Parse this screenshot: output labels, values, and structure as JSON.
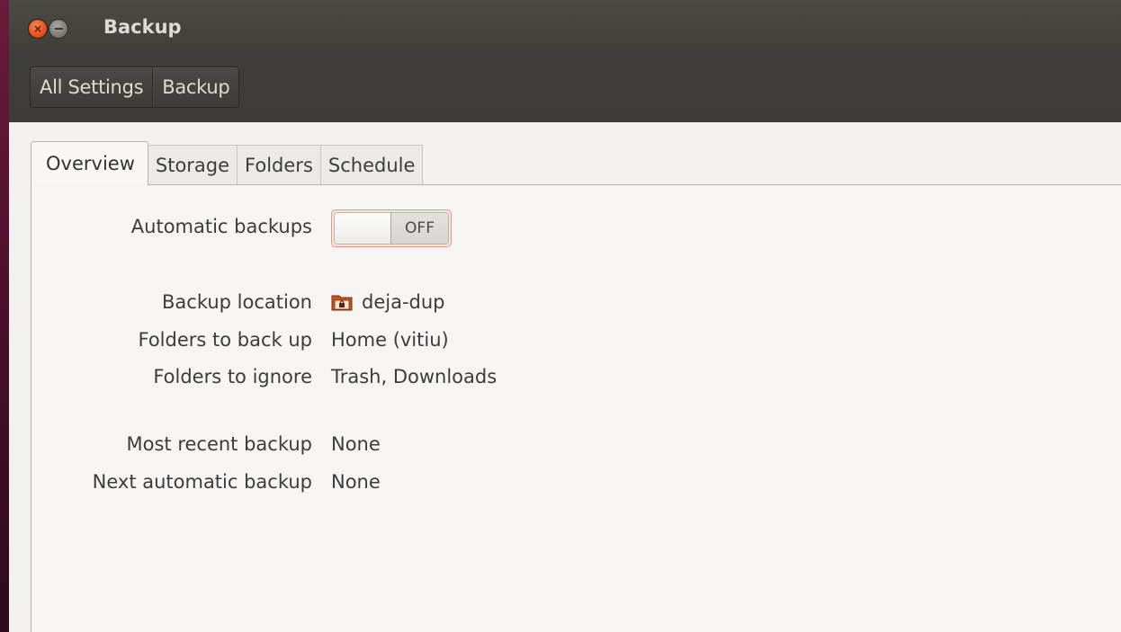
{
  "window": {
    "title": "Backup"
  },
  "breadcrumb": {
    "items": [
      {
        "label": "All Settings"
      },
      {
        "label": "Backup"
      }
    ]
  },
  "tabs": [
    {
      "label": "Overview",
      "active": true
    },
    {
      "label": "Storage",
      "active": false
    },
    {
      "label": "Folders",
      "active": false
    },
    {
      "label": "Schedule",
      "active": false
    }
  ],
  "overview": {
    "automatic_backups": {
      "label": "Automatic backups",
      "state_label": "OFF",
      "enabled": false
    },
    "backup_location": {
      "label": "Backup location",
      "value": "deja-dup",
      "icon": "folder-icon"
    },
    "folders_to_back_up": {
      "label": "Folders to back up",
      "value": "Home (vitiu)"
    },
    "folders_to_ignore": {
      "label": "Folders to ignore",
      "value": "Trash, Downloads"
    },
    "most_recent_backup": {
      "label": "Most recent backup",
      "value": "None"
    },
    "next_automatic_backup": {
      "label": "Next automatic backup",
      "value": "None"
    }
  },
  "colors": {
    "close_button": "#e9541e",
    "titlebar": "#3f3e3a",
    "toggle_focus": "#e69a7c"
  }
}
